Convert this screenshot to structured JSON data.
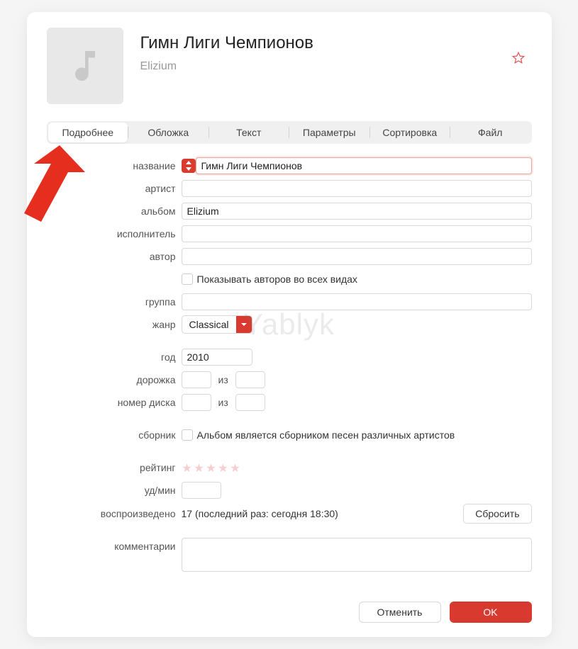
{
  "header": {
    "title": "Гимн Лиги Чемпионов",
    "subtitle": "Elizium"
  },
  "tabs": {
    "items": [
      "Подробнее",
      "Обложка",
      "Текст",
      "Параметры",
      "Сортировка",
      "Файл"
    ],
    "active_index": 0
  },
  "fields": {
    "name_label": "название",
    "name_value": "Гимн Лиги Чемпионов",
    "artist_label": "артист",
    "artist_value": "",
    "album_label": "альбом",
    "album_value": "Elizium",
    "performer_label": "исполнитель",
    "performer_value": "",
    "author_label": "автор",
    "author_value": "",
    "show_authors_label": "Показывать авторов во всех видах",
    "group_label": "группа",
    "group_value": "",
    "genre_label": "жанр",
    "genre_value": "Classical",
    "year_label": "год",
    "year_value": "2010",
    "track_label": "дорожка",
    "track_value": "",
    "track_of_label": "из",
    "track_total": "",
    "disc_label": "номер диска",
    "disc_value": "",
    "disc_of_label": "из",
    "disc_total": "",
    "compilation_label": "сборник",
    "compilation_text": "Альбом является сборником песен различных артистов",
    "rating_label": "рейтинг",
    "bpm_label": "уд/мин",
    "bpm_value": "",
    "played_label": "воспроизведено",
    "played_text": "17 (последний раз: сегодня 18:30)",
    "reset_label": "Сбросить",
    "comments_label": "комментарии",
    "comments_value": ""
  },
  "footer": {
    "cancel": "Отменить",
    "ok": "OK"
  },
  "watermark": "Yablyk"
}
